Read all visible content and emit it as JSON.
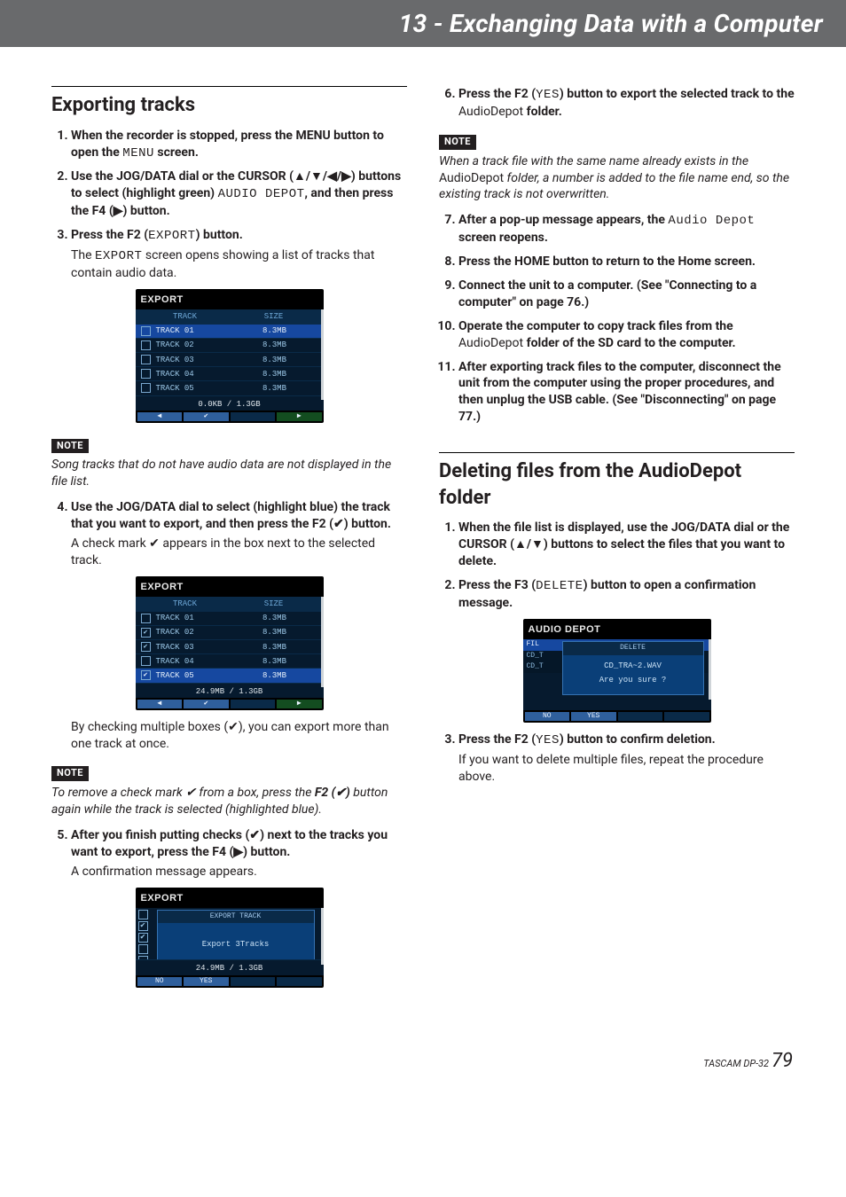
{
  "header": {
    "title": "13 - Exchanging Data with a Computer"
  },
  "left": {
    "h2": " Exporting tracks",
    "steps1": [
      {
        "html": "When the recorder is stopped, press the MENU button to open the <span class=\"mono\">MENU</span> screen."
      },
      {
        "html": "Use the JOG/DATA dial or the CURSOR (▲/▼/◀/▶) buttons to select (highlight green) <span class=\"mono\">AUDIO DEPOT</span>, and then press the F4 (▶) button."
      },
      {
        "html": "Press the F2 (<span class=\"mono\">EXPORT</span>) button.",
        "body": "The <span class=\"mono\">EXPORT</span> screen opens showing a list of tracks that contain audio data."
      }
    ],
    "ss1": {
      "title": "EXPORT",
      "header": {
        "track": "TRACK",
        "size": "SIZE"
      },
      "rows": [
        {
          "checked": false,
          "name": "TRACK 01",
          "size": "8.3MB",
          "selected": true
        },
        {
          "checked": false,
          "name": "TRACK 02",
          "size": "8.3MB"
        },
        {
          "checked": false,
          "name": "TRACK 03",
          "size": "8.3MB"
        },
        {
          "checked": false,
          "name": "TRACK 04",
          "size": "8.3MB"
        },
        {
          "checked": false,
          "name": "TRACK 05",
          "size": "8.3MB"
        }
      ],
      "footer": "0.0KB /  1.3GB",
      "buttons": [
        "◀",
        "✔",
        "",
        "▶"
      ]
    },
    "note1": {
      "label": "NOTE",
      "text": "Song tracks that do not have audio data are not displayed in the file list."
    },
    "steps2": [
      {
        "n": "4",
        "html": "Use the JOG/DATA dial to select (highlight blue) the track that you want to export, and then press the F2 (✔) button.",
        "body": "A check mark ✔ appears in the box next to the selected track."
      }
    ],
    "ss2": {
      "title": "EXPORT",
      "header": {
        "track": "TRACK",
        "size": "SIZE"
      },
      "rows": [
        {
          "checked": false,
          "name": "TRACK 01",
          "size": "8.3MB"
        },
        {
          "checked": true,
          "name": "TRACK 02",
          "size": "8.3MB"
        },
        {
          "checked": true,
          "name": "TRACK 03",
          "size": "8.3MB"
        },
        {
          "checked": false,
          "name": "TRACK 04",
          "size": "8.3MB"
        },
        {
          "checked": true,
          "name": "TRACK 05",
          "size": "8.3MB",
          "selected": true
        }
      ],
      "footer": "24.9MB /  1.3GB",
      "buttons": [
        "◀",
        "✔",
        "",
        "▶"
      ]
    },
    "body_after_ss2": "By checking multiple boxes (✔), you can export more than one track at once.",
    "note2": {
      "label": "NOTE",
      "text_html": "To remove a check mark ✔ from a box, press the <b>F2 (✔)</b> button again while the track is selected (highlighted blue)."
    },
    "steps3": [
      {
        "n": "5",
        "html": "After you finish putting checks (✔) next to the tracks you want to export, press the F4 (▶) button.",
        "body": "A confirmation message appears."
      }
    ],
    "ss3": {
      "title": "EXPORT",
      "overlay": {
        "title": "EXPORT TRACK",
        "line": "Export 3Tracks"
      },
      "left_checks": [
        false,
        true,
        true,
        false,
        false
      ],
      "footer": "24.9MB /  1.3GB",
      "buttons": [
        "NO",
        "YES",
        "",
        ""
      ]
    }
  },
  "right": {
    "steps_top": [
      {
        "n": "6",
        "html": "Press the F2 (<span class=\"mono\">YES</span>) button to export the selected track to the <span class=\"inline-body\">AudioDepot</span> folder."
      }
    ],
    "note": {
      "label": "NOTE",
      "text_html": "When a track file with the same name already exists in the <span style=\"font-style:normal\">AudioDepot</span> folder, a number is added to the file name end, so the existing track is not overwritten."
    },
    "steps_cont": [
      {
        "n": "7",
        "html": "After a pop-up message appears, the <span class=\"mono\">Audio Depot</span> screen reopens."
      },
      {
        "n": "8",
        "html": "Press the HOME button to return to the Home screen."
      },
      {
        "n": "9",
        "html": "Connect the unit to a computer. (See \"Connecting to a computer\" on page 76.)"
      },
      {
        "n": "10",
        "html": "Operate the computer to copy track files from the <span class=\"inline-body\">AudioDepot</span> folder of the SD card to the computer."
      },
      {
        "n": "11",
        "html": "After exporting track files to the computer, disconnect the unit from the computer using the proper procedures, and then unplug the USB cable. (See \"Disconnecting\" on page 77.)"
      }
    ],
    "h2_del": "Deleting files from the AudioDepot folder",
    "del_steps1": [
      {
        "n": "1",
        "html": "When the file list is displayed, use the JOG/DATA dial or the CURSOR (▲/▼) buttons to select the files that you want to delete."
      },
      {
        "n": "2",
        "html": "Press the F3 (<span class=\"mono\">DELETE</span>) button to open a confirmation message."
      }
    ],
    "ss4": {
      "title": "AUDIO DEPOT",
      "rows": [
        {
          "name": "FIL",
          "sel": true
        },
        {
          "name": "CD_T"
        },
        {
          "name": "CD_T"
        }
      ],
      "dialog": {
        "title": "DELETE",
        "line1": "CD_TRA~2.WAV",
        "line2": "Are you sure ?"
      },
      "buttons": [
        "NO",
        "YES",
        "",
        ""
      ]
    },
    "del_steps2": [
      {
        "n": "3",
        "html": "Press the F2 (<span class=\"mono\">YES</span>) button to confirm deletion.",
        "body": "If you want to delete multiple files, repeat the procedure above."
      }
    ]
  },
  "footer": {
    "brand": "TASCAM DP-32",
    "page": "79"
  }
}
